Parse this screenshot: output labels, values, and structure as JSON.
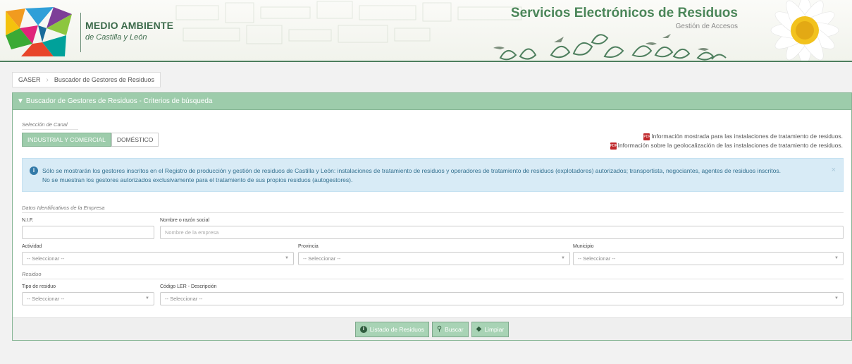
{
  "header": {
    "logo_title": "MEDIO AMBIENTE",
    "logo_subtitle": "de Castilla y León",
    "site_title": "Servicios Electrónicos de Residuos",
    "site_subtitle": "Gestión de Accesos"
  },
  "breadcrumb": {
    "root": "GASER",
    "current": "Buscador de Gestores de Residuos"
  },
  "panel": {
    "title": "Buscador de Gestores de Residuos - Criterios de búsqueda"
  },
  "canal": {
    "label": "Selección de Canal",
    "tabs": [
      {
        "label": "INDUSTRIAL Y COMERCIAL",
        "active": true
      },
      {
        "label": "DOMÉSTICO",
        "active": false
      }
    ]
  },
  "links": [
    {
      "label": "Información mostrada para las instalaciones de tratamiento de residuos.",
      "icon": "pdf-icon"
    },
    {
      "label": "Información sobre la geolocalización de las instalaciones de tratamiento de residuos.",
      "icon": "pdf-icon"
    }
  ],
  "info": {
    "line1": "Sólo se mostrarán los gestores inscritos en el Registro de producción y gestión de residuos de Castilla y León: instalaciones de tratamiento de residuos y operadores de tratamiento de residuos (explotadores) autorizados; transportista, negociantes, agentes de residuos inscritos.",
    "line2": "No se muestran los gestores autorizados exclusivamente para el tratamiento de sus propios residuos (autogestores).",
    "close": "×"
  },
  "empresa": {
    "section": "Datos Identificativos de la Empresa",
    "nif_label": "N.I.F.",
    "nif_value": "",
    "nombre_label": "Nombre o razón social",
    "nombre_placeholder": "Nombre de la empresa",
    "actividad_label": "Actividad",
    "actividad_value": "-- Seleccionar --",
    "provincia_label": "Provincia",
    "provincia_value": "-- Seleccionar --",
    "municipio_label": "Municipio",
    "municipio_value": "-- Seleccionar --"
  },
  "residuo": {
    "section": "Residuo",
    "tipo_label": "Tipo de residuo",
    "tipo_value": "-- Seleccionar --",
    "ler_label": "Código LER - Descripción",
    "ler_value": "-- Seleccionar --"
  },
  "buttons": {
    "listado": "Listado de Residuos",
    "buscar": "Buscar",
    "limpiar": "Limpiar"
  },
  "colors": {
    "accent": "#9dccab",
    "brand_green": "#4b8659",
    "info_bg": "#d8ebf6"
  }
}
